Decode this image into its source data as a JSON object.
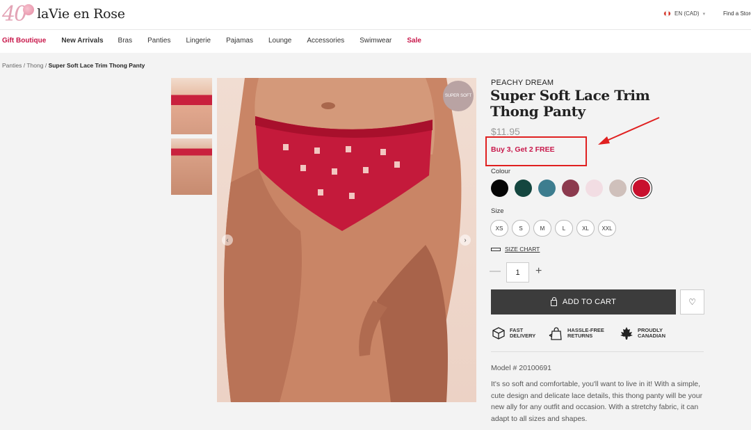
{
  "header": {
    "logo_number": "40",
    "logo_text": "laVie en Rose",
    "language": "EN (CAD)",
    "find_store": "Find a Store"
  },
  "nav": {
    "items": [
      "Gift Boutique",
      "New Arrivals",
      "Bras",
      "Panties",
      "Lingerie",
      "Pajamas",
      "Lounge",
      "Accessories",
      "Swimwear",
      "Sale"
    ]
  },
  "breadcrumb": {
    "items": [
      "Panties",
      "Thong"
    ],
    "separator": "/",
    "current": "Super Soft Lace Trim Thong Panty"
  },
  "gallery": {
    "badge": "SUPER SOFT",
    "prev": "‹",
    "next": "›"
  },
  "product": {
    "brand": "PEACHY DREAM",
    "title": "Super Soft Lace Trim Thong Panty",
    "price": "$11.95",
    "promo": "Buy 3, Get 2 FREE",
    "colour_label": "Colour",
    "colours": [
      "#050505",
      "#14463f",
      "#3d7d8f",
      "#8c3a4e",
      "#f2dde3",
      "#cfc0bb",
      "#c8102e"
    ],
    "selected_colour_index": 6,
    "size_label": "Size",
    "sizes": [
      "XS",
      "S",
      "M",
      "L",
      "XL",
      "XXL"
    ],
    "size_chart": "SIZE CHART",
    "quantity": "1",
    "qty_minus": "—",
    "qty_plus": "+",
    "add_to_cart": "ADD TO CART",
    "wishlist_icon": "♡",
    "features": [
      {
        "icon": "box-icon",
        "line1": "FAST",
        "line2": "DELIVERY"
      },
      {
        "icon": "return-bag-icon",
        "line1": "HASSLE-FREE",
        "line2": "RETURNS"
      },
      {
        "icon": "maple-leaf-icon",
        "line1": "PROUDLY",
        "line2": "CANADIAN"
      }
    ],
    "model": "Model # 20100691",
    "description": "It's so soft and comfortable, you'll want to live in it! With a simple, cute design and delicate lace details, this thong panty will be your new ally for any outfit and occasion. With a stretchy fabric, it can adapt to all sizes and shapes."
  },
  "colors": {
    "accent": "#c8174a",
    "annotation": "#e02020",
    "cart_button": "#3c3c3c"
  }
}
